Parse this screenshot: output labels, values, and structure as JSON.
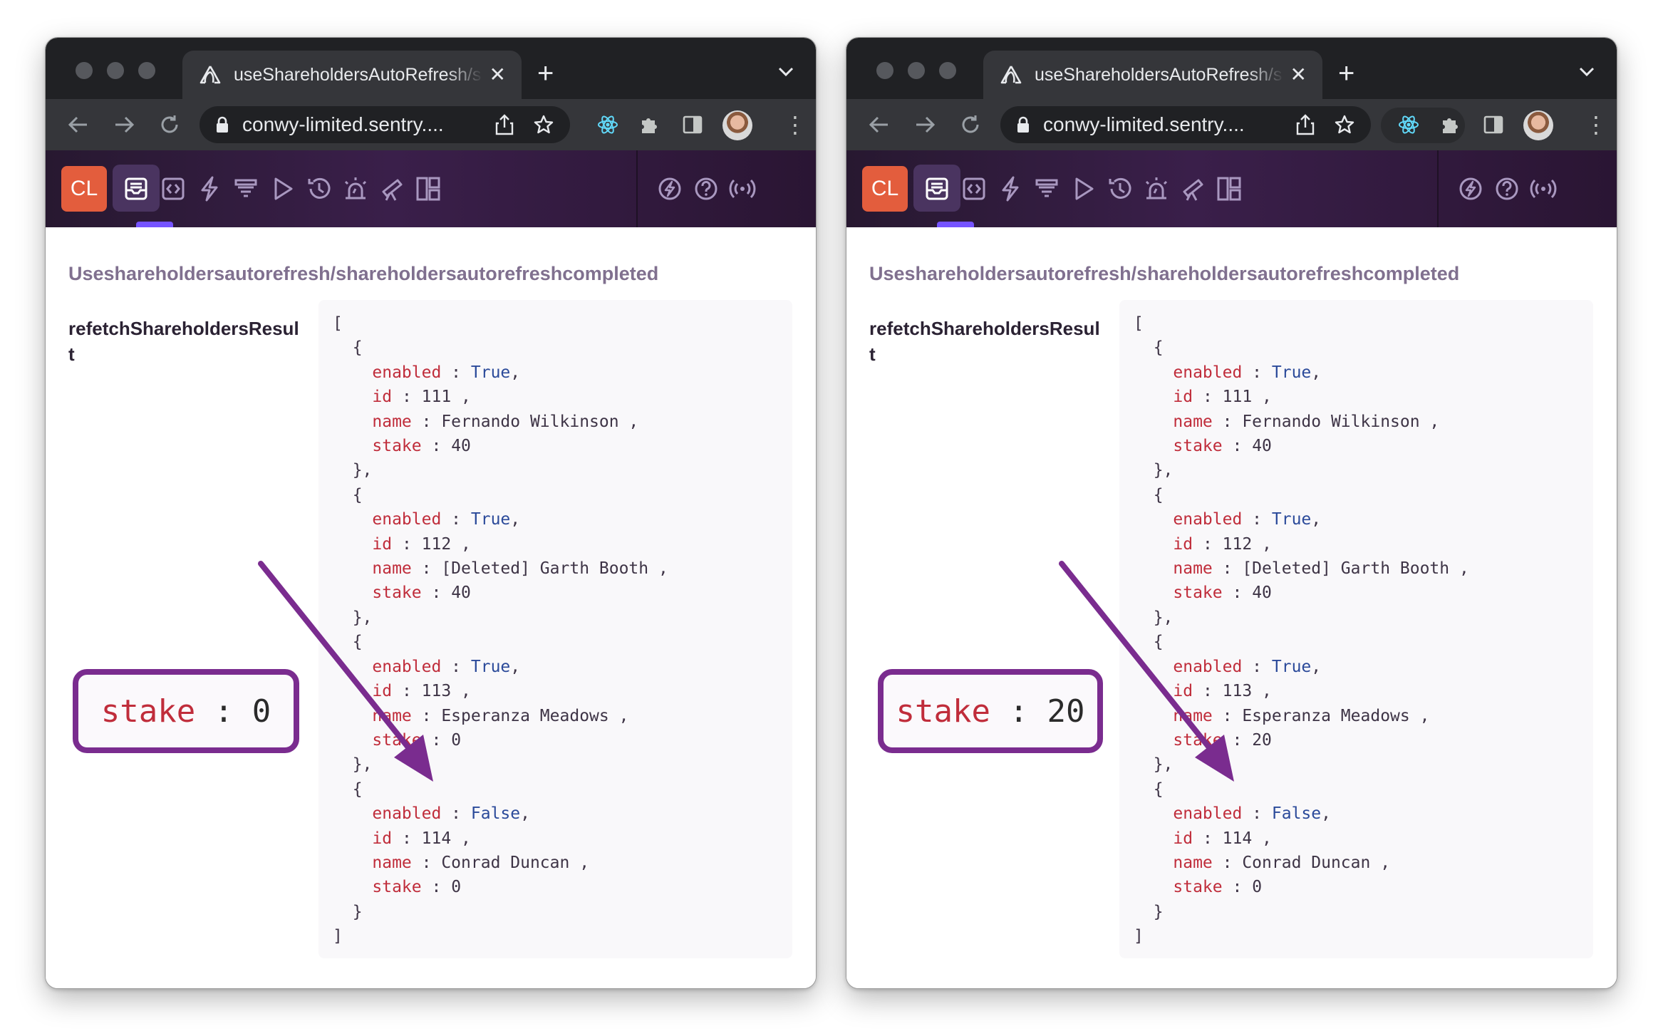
{
  "windows": [
    {
      "tab": {
        "title": "useShareholdersAutoRefresh/s"
      },
      "url": "conwy-limited.sentry....",
      "sentry_toolbar": {
        "org_badge": "CL"
      },
      "content": {
        "title": "Useshareholdersautorefresh/shareholdersautorefreshcompleted",
        "prop_label": "refetchShareholdersResult",
        "json": {
          "open": "[",
          "close": "]",
          "entries": [
            {
              "enabled": "True",
              "id": "111",
              "name": "Fernando Wilkinson",
              "stake": "40"
            },
            {
              "enabled": "True",
              "id": "112",
              "name": "[Deleted] Garth Booth",
              "stake": "40"
            },
            {
              "enabled": "True",
              "id": "113",
              "name": "Esperanza Meadows",
              "stake": "0"
            },
            {
              "enabled": "False",
              "id": "114",
              "name": "Conrad Duncan",
              "stake": "0"
            }
          ]
        },
        "callout": {
          "key": "stake",
          "value": "0"
        }
      }
    },
    {
      "tab": {
        "title": "useShareholdersAutoRefresh/s"
      },
      "url": "conwy-limited.sentry....",
      "sentry_toolbar": {
        "org_badge": "CL"
      },
      "content": {
        "title": "Useshareholdersautorefresh/shareholdersautorefreshcompleted",
        "prop_label": "refetchShareholdersResult",
        "json": {
          "open": "[",
          "close": "]",
          "entries": [
            {
              "enabled": "True",
              "id": "111",
              "name": "Fernando Wilkinson",
              "stake": "40"
            },
            {
              "enabled": "True",
              "id": "112",
              "name": "[Deleted] Garth Booth",
              "stake": "40"
            },
            {
              "enabled": "True",
              "id": "113",
              "name": "Esperanza Meadows",
              "stake": "20"
            },
            {
              "enabled": "False",
              "id": "114",
              "name": "Conrad Duncan",
              "stake": "0"
            }
          ]
        },
        "callout": {
          "key": "stake",
          "value": "20"
        }
      }
    }
  ],
  "icons": {
    "tab": [
      "sentry-logo-icon",
      "close-icon",
      "plus-icon",
      "chevron-down-icon"
    ],
    "toolbar": [
      "back-arrow-icon",
      "forward-arrow-icon",
      "reload-icon",
      "lock-icon",
      "share-icon",
      "star-icon",
      "react-devtools-icon",
      "puzzle-extensions-icon",
      "side-panel-icon",
      "avatar",
      "kebab-menu-icon"
    ],
    "sentry_toolbar": [
      "issues-inbox-icon",
      "code-brackets-icon",
      "lightning-icon",
      "funnel-icon",
      "play-icon",
      "history-clock-icon",
      "alert-siren-icon",
      "telescope-icon",
      "dashboards-grid-icon",
      "feedback-icon",
      "bolt-circle-icon",
      "help-circle-icon",
      "broadcast-icon"
    ]
  },
  "colors": {
    "tab_strip": "#202124",
    "toolbar": "#35363a",
    "sentry_bar": "#3a1f4a",
    "org_badge": "#e35d3d",
    "json_key": "#c02d3b",
    "json_boolean": "#2b4a9a",
    "callout_border": "#7a2c8f",
    "arrow": "#7a2c8f"
  }
}
